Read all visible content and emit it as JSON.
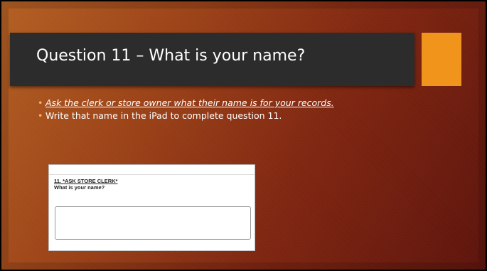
{
  "slide": {
    "title": "Question 11 – What is your name?",
    "accent_color": "#f0941c",
    "bullets": [
      {
        "icon": "bullet-dot",
        "text": "Ask the clerk or store owner what their name is for your records."
      },
      {
        "icon": "bullet-dot",
        "text": "Write that name in the iPad to complete question 11."
      }
    ],
    "form": {
      "question_number_line": "11. *ASK STORE CLERK*",
      "question_text": "What is your name?",
      "answer_value": ""
    }
  }
}
